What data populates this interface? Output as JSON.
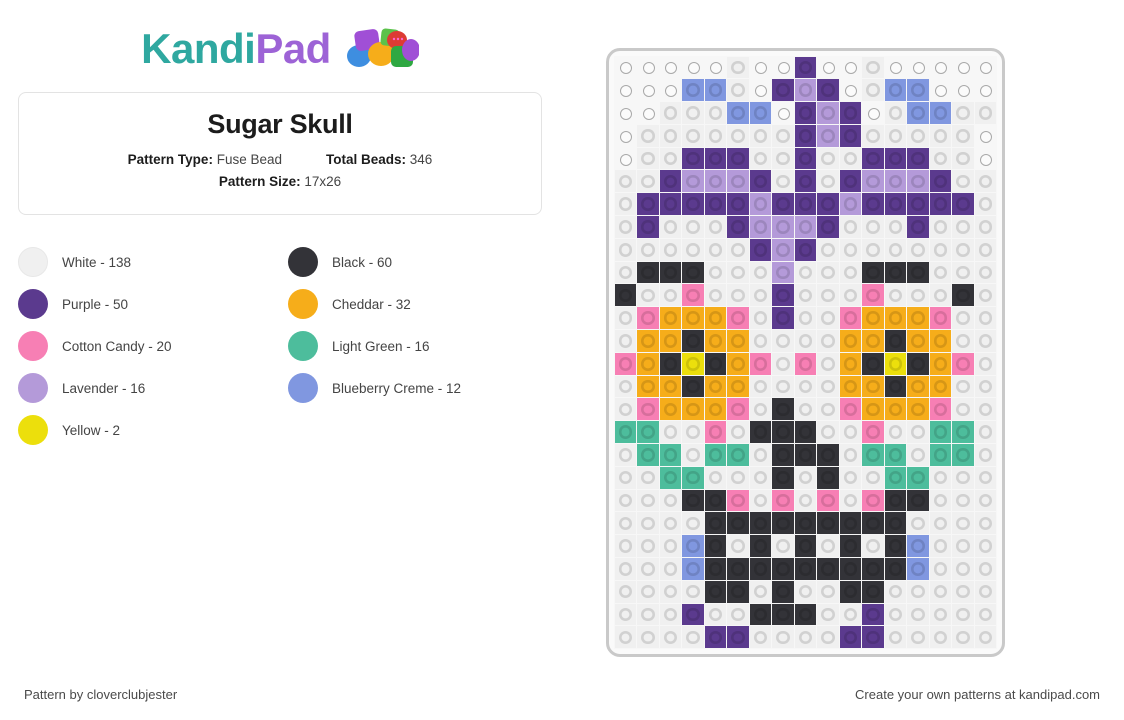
{
  "brand": {
    "name_part1": "Kandi",
    "name_part2": "Pad",
    "color_teal": "#2fa8a0",
    "color_purple": "#9d63d6"
  },
  "pattern": {
    "title": "Sugar Skull",
    "type_label": "Pattern Type:",
    "type_value": "Fuse Bead",
    "total_label": "Total Beads:",
    "total_value": "346",
    "size_label": "Pattern Size:",
    "size_value": "17x26"
  },
  "legend": [
    {
      "name": "White",
      "count": "138",
      "label": "White - 138",
      "hex": "#f0f0f0"
    },
    {
      "name": "Black",
      "count": "60",
      "label": "Black - 60",
      "hex": "#333338"
    },
    {
      "name": "Purple",
      "count": "50",
      "label": "Purple - 50",
      "hex": "#5b3a8e"
    },
    {
      "name": "Cheddar",
      "count": "32",
      "label": "Cheddar - 32",
      "hex": "#f6ad1a"
    },
    {
      "name": "Cotton Candy",
      "count": "20",
      "label": "Cotton Candy - 20",
      "hex": "#f77fb4"
    },
    {
      "name": "Light Green",
      "count": "16",
      "label": "Light Green - 16",
      "hex": "#4dbd9c"
    },
    {
      "name": "Lavender",
      "count": "16",
      "label": "Lavender - 16",
      "hex": "#b49ad9"
    },
    {
      "name": "Blueberry Creme",
      "count": "12",
      "label": "Blueberry Creme - 12",
      "hex": "#8097e0"
    },
    {
      "name": "Yellow",
      "count": "2",
      "label": "Yellow - 2",
      "hex": "#ecdf0c"
    }
  ],
  "board": {
    "cols": 17,
    "rows": 26,
    "palette": {
      "W": "#f0f0f0",
      "K": "#333338",
      "P": "#5b3a8e",
      "C": "#f6ad1a",
      "N": "#f77fb4",
      "G": "#4dbd9c",
      "L": "#b49ad9",
      "B": "#8097e0",
      "Y": "#ecdf0c",
      ".": null
    },
    "rows_data": [
      ".....W..P..W.....",
      "...BBW.PLP.WBB...",
      "..WWWBB PLP WBBWW",
      ".WWWWWWWPLPWWWWW.",
      ".WWPPPWWPWWPPPWW.",
      "WWPLLLPWPWPLLLPWW",
      "WPPPPPLPPPLPPPPPW",
      "WPWWWPLLLPWWWPWWW",
      "WWWWWWPLPWWWWWWWW",
      "WKKKWWWLWWWKKKWWW",
      "KWWNWWWPWWWNWWWKW",
      "WNCCCNWPWWNCCCNWW",
      "WCCKCCWWWWCCKCCWW",
      "NCKYKCNWNWCKYKCNW",
      "WCCKCCWWWWCCKCCWW",
      "WNCCCNWKWWNCCCNWW",
      "GGWWNWKKKWWNWWGGW",
      "WGGWGGWKKKWGGWGGW",
      "WWGGWWWKWKWWGGWWW",
      "WWWKKNWNWNWNKKWWW",
      "WWWWKKKKKKKKKWWWW",
      "WWWBKWKWKWKWKBWWW",
      "WWWBKKKKKKKKKBWWW",
      "WWWWKKWKWWKKWWWWW",
      "WWWPWWKKKWWPWWWWW",
      "WWWWPPWWWWPPWWWWW"
    ]
  },
  "footer": {
    "left": "Pattern by cloverclubjester",
    "right": "Create your own patterns at kandipad.com"
  }
}
